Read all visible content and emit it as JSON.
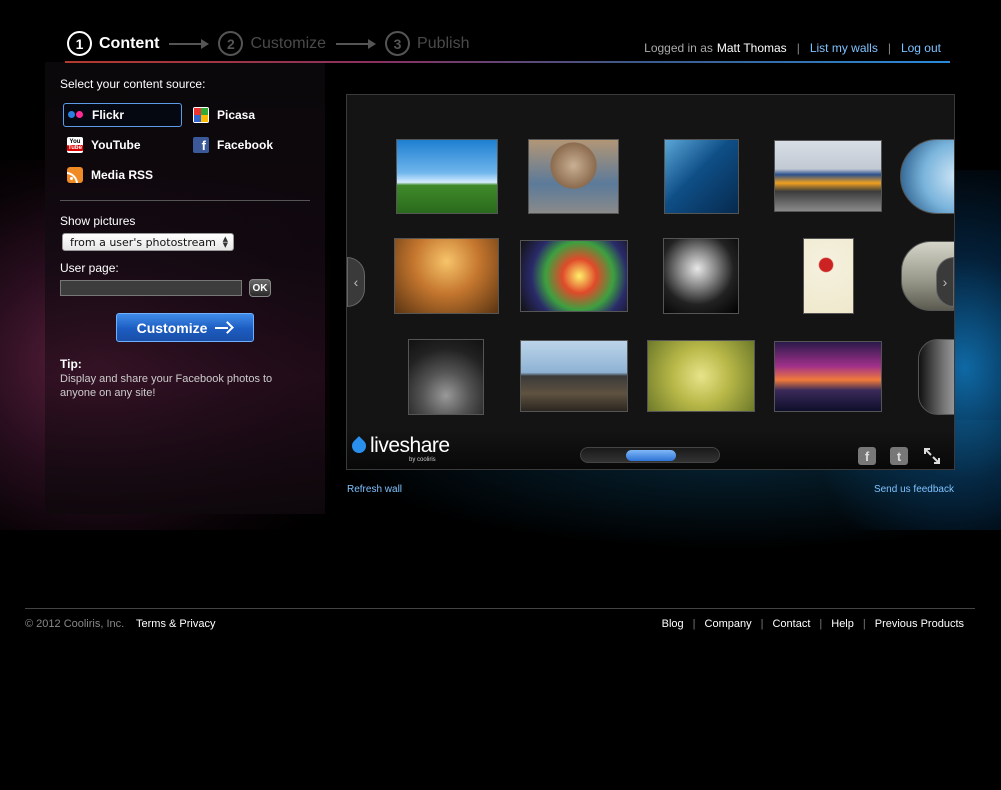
{
  "header": {
    "steps": [
      {
        "num": "1",
        "label": "Content"
      },
      {
        "num": "2",
        "label": "Customize"
      },
      {
        "num": "3",
        "label": "Publish"
      }
    ],
    "logged_in_prefix": "Logged in as",
    "user_name": "Matt Thomas",
    "list_walls_link": "List my walls",
    "logout_link": "Log out"
  },
  "sidebar": {
    "source_heading": "Select your content source:",
    "sources": [
      {
        "label": "Flickr",
        "icon": "flickr-icon",
        "selected": true
      },
      {
        "label": "Picasa",
        "icon": "picasa-icon",
        "selected": false
      },
      {
        "label": "YouTube",
        "icon": "youtube-icon",
        "selected": false
      },
      {
        "label": "Facebook",
        "icon": "facebook-icon",
        "selected": false
      },
      {
        "label": "Media RSS",
        "icon": "rss-icon",
        "selected": false
      }
    ],
    "show_pictures_label": "Show pictures",
    "show_pictures_value": "from a user's photostream",
    "user_page_label": "User page:",
    "user_page_value": "",
    "ok_label": "OK",
    "customize_label": "Customize",
    "tip_title": "Tip:",
    "tip_text": "Display and share your Facebook photos to anyone on any site!"
  },
  "wall": {
    "logo_text": "liveshare",
    "logo_sub": "by cooliris",
    "refresh_link": "Refresh wall",
    "feedback_link": "Send us feedback"
  },
  "footer": {
    "copyright": "© 2012 Cooliris, Inc.",
    "terms": "Terms & Privacy",
    "links": [
      "Blog",
      "Company",
      "Contact",
      "Help",
      "Previous Products"
    ]
  },
  "colors": {
    "accent_link": "#7ec2ff",
    "customize_button": "#1c5cc0",
    "flickr_blue": "#2a7fe0",
    "flickr_pink": "#ff2a93"
  }
}
